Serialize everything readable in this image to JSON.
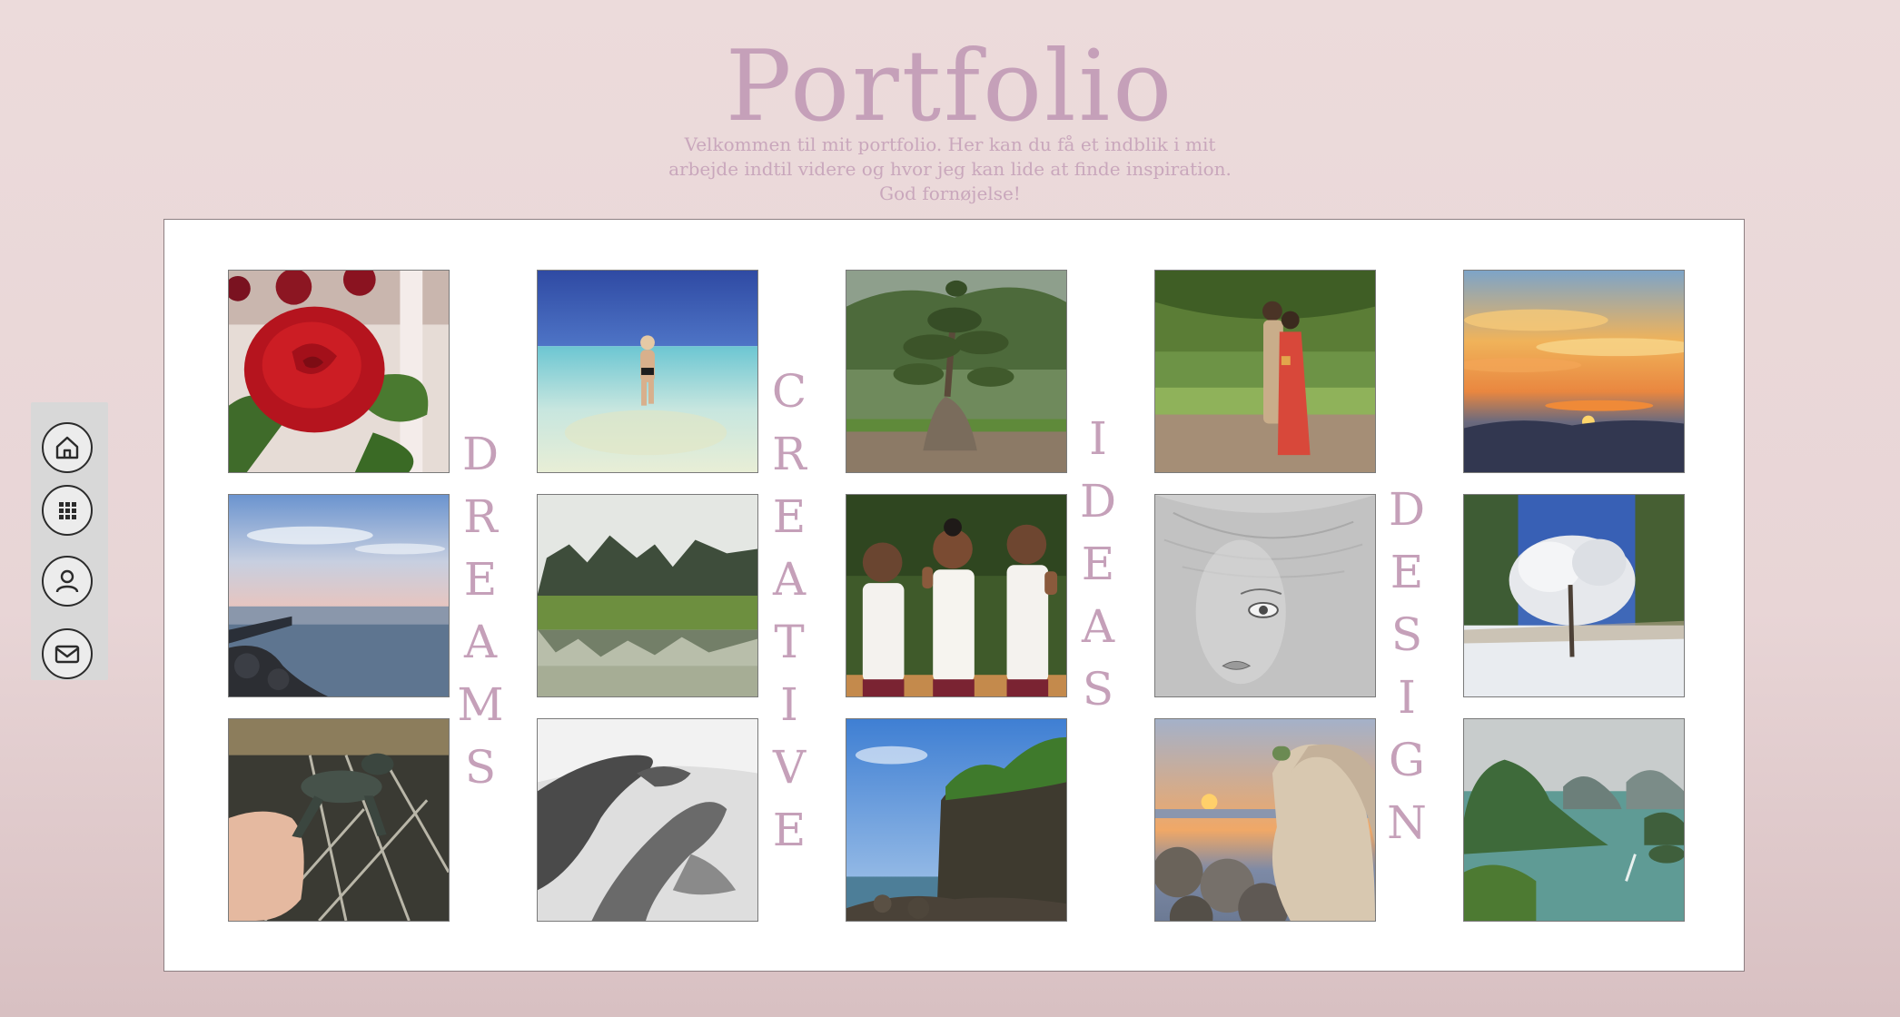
{
  "header": {
    "title": "Portfolio",
    "subtitle_lines": [
      "Velkommen til mit portfolio. Her kan du få et indblik i mit",
      "arbejde indtil videre og hvor jeg kan lide at finde inspiration.",
      "God fornøjelse!"
    ]
  },
  "side_nav": [
    {
      "icon": "home-icon",
      "label": "Home"
    },
    {
      "icon": "grid-icon",
      "label": "Gallery"
    },
    {
      "icon": "user-icon",
      "label": "About"
    },
    {
      "icon": "mail-icon",
      "label": "Contact"
    }
  ],
  "gallery": {
    "words": [
      "DREAMS",
      "CREATIVE",
      "IDEAS",
      "DESIGN"
    ],
    "photos": [
      {
        "name": "rose-photo",
        "subject": "red rose"
      },
      {
        "name": "beach-walk-photo",
        "subject": "woman walking in shallow sea"
      },
      {
        "name": "bonsai-tree-photo",
        "subject": "large bonsai tree"
      },
      {
        "name": "wedding-couple-photo",
        "subject": "couple embracing under tree"
      },
      {
        "name": "sunset-clouds-photo",
        "subject": "sunset over mountains"
      },
      {
        "name": "seaside-evening-photo",
        "subject": "calm sea at dusk"
      },
      {
        "name": "rice-field-photo",
        "subject": "rice field with karst mountains"
      },
      {
        "name": "children-waving-photo",
        "subject": "three children waving"
      },
      {
        "name": "pencil-drawing-photo",
        "subject": "pencil drawing of a face"
      },
      {
        "name": "snowy-tree-photo",
        "subject": "frosted tree in snow"
      },
      {
        "name": "baby-turtle-photo",
        "subject": "baby turtle in hand"
      },
      {
        "name": "holding-hands-photo",
        "subject": "black and white hands"
      },
      {
        "name": "coastal-cliff-photo",
        "subject": "rocky coastal cliff"
      },
      {
        "name": "woman-sunset-photo",
        "subject": "woman watching sunset"
      },
      {
        "name": "halong-bay-photo",
        "subject": "bay with limestone islands"
      }
    ]
  }
}
